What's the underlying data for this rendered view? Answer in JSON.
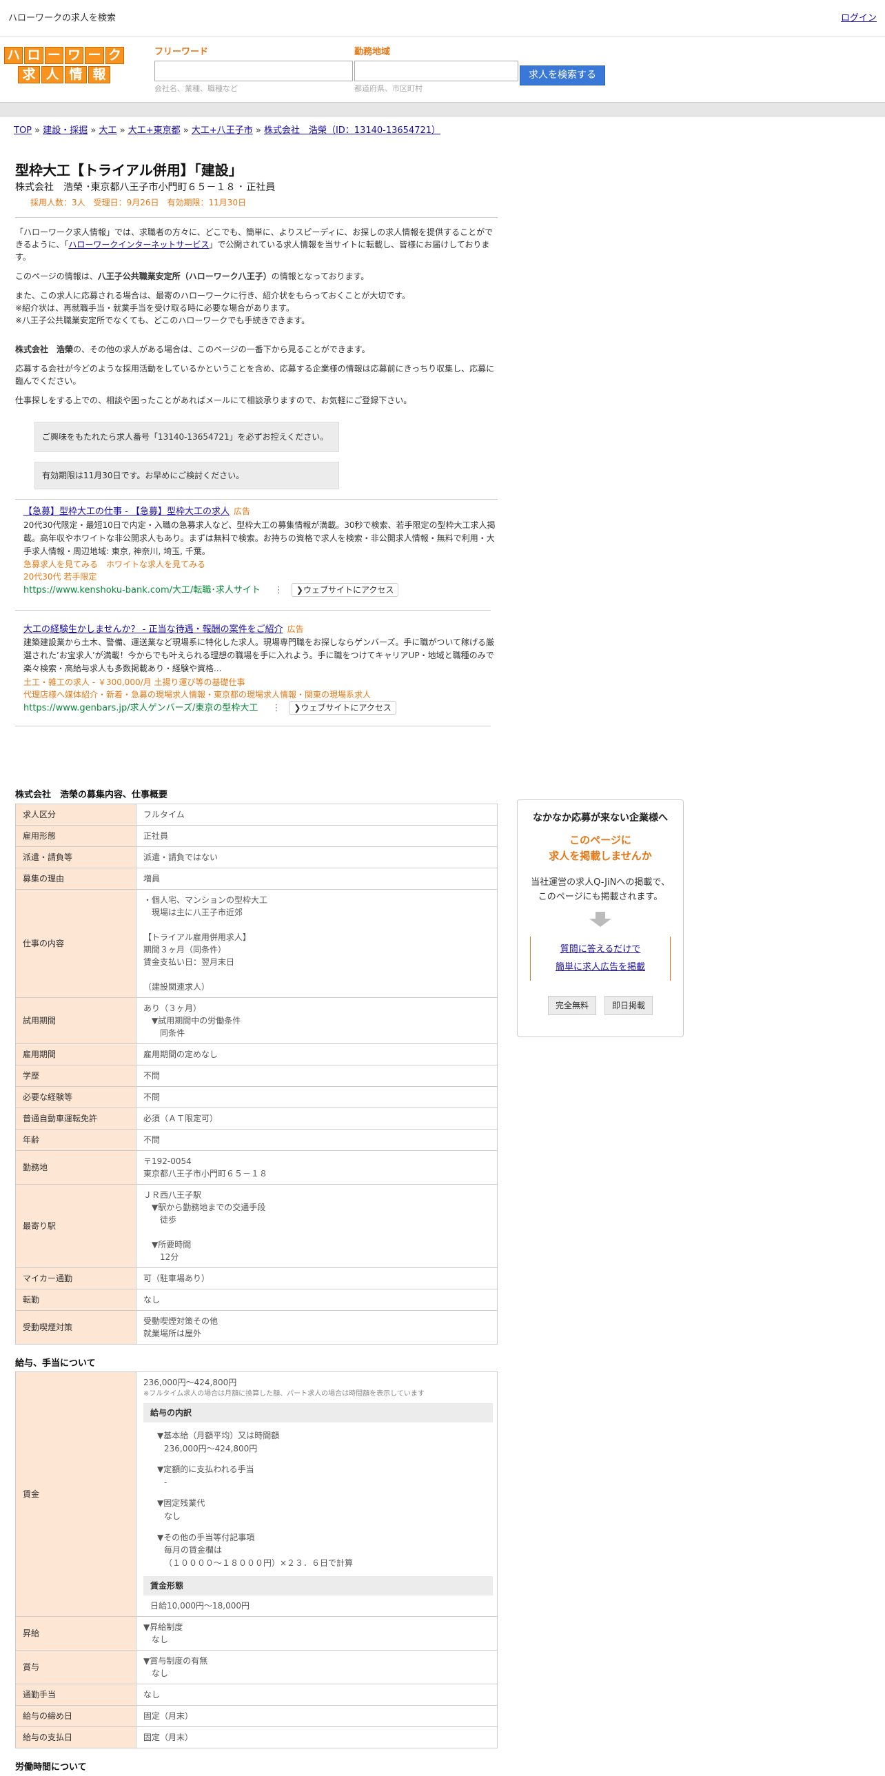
{
  "topbar": {
    "title": "ハローワークの求人を検索",
    "login": "ログイン"
  },
  "logo": {
    "row1": [
      "ハ",
      "ロ",
      "ー",
      "ワ",
      "ー",
      "ク"
    ],
    "row2": [
      "求",
      "人",
      "情",
      "報"
    ]
  },
  "search": {
    "kw_label": "フリーワード",
    "kw_hint": "会社名、業種、職種など",
    "area_label": "勤務地域",
    "area_hint": "都道府県、市区町村",
    "button": "求人を検索する"
  },
  "breadcrumb": [
    "TOP",
    "建設・採掘",
    "大工",
    "大工+東京都",
    "大工+八王子市",
    "株式会社　浩榮（ID：13140-13654721）"
  ],
  "job": {
    "title": "型枠大工【トライアル併用】「建設」",
    "company": "株式会社　浩榮 ･東京都八王子市小門町６５－１８ ･ 正社員",
    "meta": "採用人数：3人　受理日：9月26日　有効期限：11月30日"
  },
  "intro": {
    "p1a": "「ハローワーク求人情報」では、求職者の方々に、どこでも、簡単に、よりスピーディに、お探しの求人情報を提供することができるように、「",
    "p1link": "ハローワークインターネットサービス",
    "p1b": "」で公開されている求人情報を当サイトに転載し、皆様にお届けしております。",
    "p2a": "このページの情報は、",
    "p2b": "八王子公共職業安定所（ハローワーク八王子）",
    "p2c": "の情報となっております。",
    "p3": "また、この求人に応募される場合は、最寄のハローワークに行き、紹介状をもらっておくことが大切です。",
    "p4": "※紹介状は、再就職手当・就業手当を受け取る時に必要な場合があります。",
    "p5": "※八王子公共職業安定所でなくても、どこのハローワークでも手続きできます。",
    "p6a": "株式会社　浩榮",
    "p6b": "の、その他の求人がある場合は、このページの一番下から見ることができます。",
    "p7": "応募する会社が今どのような採用活動をしているかということを含め、応募する企業様の情報は応募前にきっちり収集し、応募に臨んでください。",
    "p8": "仕事探しをする上での、相談や困ったことがあればメールにて相談承りますので、お気軽にご登録下さい。"
  },
  "notes": [
    "ご興味をもたれたら求人番号「13140-13654721」を必ずお控えください。",
    "有効期限は11月30日です。お早めにご検討ください。"
  ],
  "ads": [
    {
      "title": "【急募】型枠大工の仕事 - 【急募】型枠大工の求人",
      "tag": "広告",
      "desc": "20代30代限定・最短10日で内定・入職の急募求人など、型枠大工の募集情報が満載。30秒で検索、若手限定の型枠大工求人掲載。高年収やホワイトな非公開求人もあり。まずは無料で検索。お持ちの資格で求人を検索・非公開求人情報・無料で利用・大手求人情報・周辺地域: 東京, 神奈川, 埼玉, 千葉。",
      "opt1": "急募求人を見てみる　ホワイトな求人を見てみる",
      "opt2": "20代30代 若手限定",
      "url": "https://www.kenshoku-bank.com/大工/転職･求人サイト",
      "btn": "❯ウェブサイトにアクセス"
    },
    {
      "title": "大工の経験生かしませんか？ - 正当な待遇・報酬の案件をご紹介",
      "tag": "広告",
      "desc": "建築建設業から土木、警備、運送業など現場系に特化した求人。現場専門職をお探しならゲンバーズ。手に職がついて稼げる厳選された’お宝求人’が満載！今からでも叶えられる理想の職場を手に入れよう。手に職をつけてキャリアUP・地域と職種のみで楽々検索・高給与求人も多数掲載あり・経験や資格...",
      "opt1": "土工・雑工の求人 - ￥300,000/月 土揚り運び等の基礎仕事",
      "opt2": "代理店様へ媒体紹介・新着・急募の現場求人情報・東京都の現場求人情報・関東の現場系求人",
      "url": "https://www.genbars.jp/求人ゲンバーズ/東京の型枠大工",
      "btn": "❯ウェブサイトにアクセス"
    }
  ],
  "spec": {
    "heading": "株式会社　浩榮の募集内容、仕事概要",
    "rows": [
      [
        "求人区分",
        "フルタイム"
      ],
      [
        "雇用形態",
        "正社員"
      ],
      [
        "派遣・請負等",
        "派遣・請負ではない"
      ],
      [
        "募集の理由",
        "増員"
      ],
      [
        "仕事の内容",
        "・個人宅、マンションの型枠大工\n　現場は主に八王子市近郊\n\n【トライアル雇用併用求人】\n期間３ヶ月（同条件）\n賃金支払い日：翌月末日\n\n（建設関連求人）"
      ],
      [
        "試用期間",
        "あり（３ヶ月）\n　▼試用期間中の労働条件\n　　同条件"
      ],
      [
        "雇用期間",
        "雇用期間の定めなし"
      ],
      [
        "学歴",
        "不問"
      ],
      [
        "必要な経験等",
        "不問"
      ],
      [
        "普通自動車運転免許",
        "必須（ＡＴ限定可）"
      ],
      [
        "年齢",
        "不問"
      ],
      [
        "勤務地",
        "〒192-0054\n東京都八王子市小門町６５－１８"
      ],
      [
        "最寄り駅",
        "ＪＲ西八王子駅\n　▼駅から勤務地までの交通手段\n　　徒歩\n\n　▼所要時間\n　　12分"
      ],
      [
        "マイカー通勤",
        "可（駐車場あり）"
      ],
      [
        "転勤",
        "なし"
      ],
      [
        "受動喫煙対策",
        "受動喫煙対策その他\n就業場所は屋外"
      ]
    ]
  },
  "side": {
    "h": "なかなか応募が来ない企業様へ",
    "o1": "このページに",
    "o2": "求人を掲載しませんか",
    "p1": "当社運営の求人Q-JiNへの掲載で、",
    "p2": "このページにも掲載されます。",
    "l1": "質問に答えるだけで",
    "l2": "簡単に求人広告を掲載",
    "b1": "完全無料",
    "b2": "即日掲載"
  },
  "pay": {
    "heading": "給与、手当について",
    "wage_k": "賃金",
    "range": "236,000円〜424,800円",
    "note": "※フルタイム求人の場合は月額に換算した額、パート求人の場合は時間額を表示しています",
    "breakdown_h": "給与の内訳",
    "b1": "▼基本給（月額平均）又は時間額",
    "b1v": "236,000円〜424,800円",
    "b2": "▼定額的に支払われる手当",
    "b2v": "-",
    "b3": "▼固定残業代",
    "b3v": "なし",
    "b4": "▼その他の手当等付記事項",
    "b4v1": "毎月の賃金欄は",
    "b4v2": "（１００００～１８０００円）×２３．６日で計算",
    "form_h": "賃金形態",
    "form_v": "日給10,000円〜18,000円",
    "rows": [
      [
        "昇給",
        "▼昇給制度\n　なし"
      ],
      [
        "賞与",
        "▼賞与制度の有無\n　なし"
      ],
      [
        "通勤手当",
        "なし"
      ],
      [
        "給与の締め日",
        "固定（月末）"
      ],
      [
        "給与の支払日",
        "固定（月末）"
      ]
    ]
  },
  "hours": {
    "heading": "労働時間について"
  }
}
